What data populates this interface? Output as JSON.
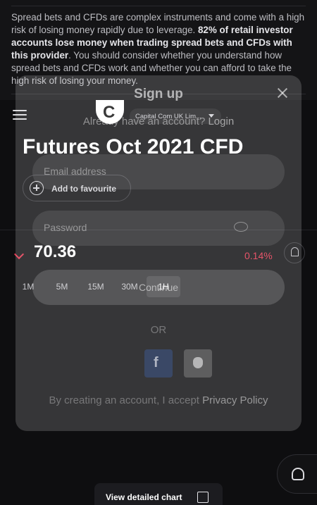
{
  "risk": {
    "text_intro": "Spread bets and CFDs are complex instruments and come with a high risk of losing money rapidly due to leverage. ",
    "text_bold": "82% of retail investor accounts lose money when trading spread bets and CFDs with this provider",
    "text_outro": ". You should consider whether you understand how spread bets and CFDs work and whether you can afford to take the high risk of losing your money."
  },
  "header": {
    "logo_letter": "C",
    "entity": "Capital Com UK Lim..."
  },
  "instrument": {
    "title": "Futures Oct 2021 CFD",
    "favourite_label": "Add to favourite",
    "price": "70.36",
    "change": "0.14%",
    "timeframes": [
      "1M",
      "5M",
      "15M",
      "30M",
      "1H"
    ],
    "active_timeframe": "1H"
  },
  "modal": {
    "title": "Sign up",
    "account_question": "Already have an account?",
    "login_link": "Login",
    "email_placeholder": "Email address",
    "password_placeholder": "Password",
    "submit_label": "Continue",
    "or_label": "OR",
    "terms_prefix": "By creating an account, I accept",
    "privacy_link": "Privacy Policy"
  },
  "bottom": {
    "chart_button_label": "View detailed chart"
  },
  "colors": {
    "negative": "#e0324b",
    "background": "#0e0e10"
  }
}
